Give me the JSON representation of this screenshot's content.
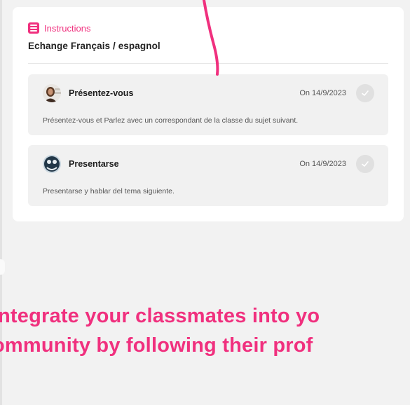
{
  "instructions": {
    "label": "Instructions",
    "icon": "list-icon",
    "accent_color": "#f0307e"
  },
  "activity": {
    "title": "Echange Français / espagnol"
  },
  "tasks": [
    {
      "name": "Présentez-vous",
      "date": "On 14/9/2023",
      "description": "Présentez-vous et Parlez avec un correspondant de la classe du sujet suivant.",
      "status_icon": "check-icon"
    },
    {
      "name": "Presentarse",
      "date": "On 14/9/2023",
      "description": "Presentarse y hablar del tema siguiente.",
      "status_icon": "check-icon"
    }
  ],
  "promo": {
    "line1": "ntegrate your classmates into yo",
    "line2": "ommunity by following their prof",
    "color": "#f0307e"
  }
}
